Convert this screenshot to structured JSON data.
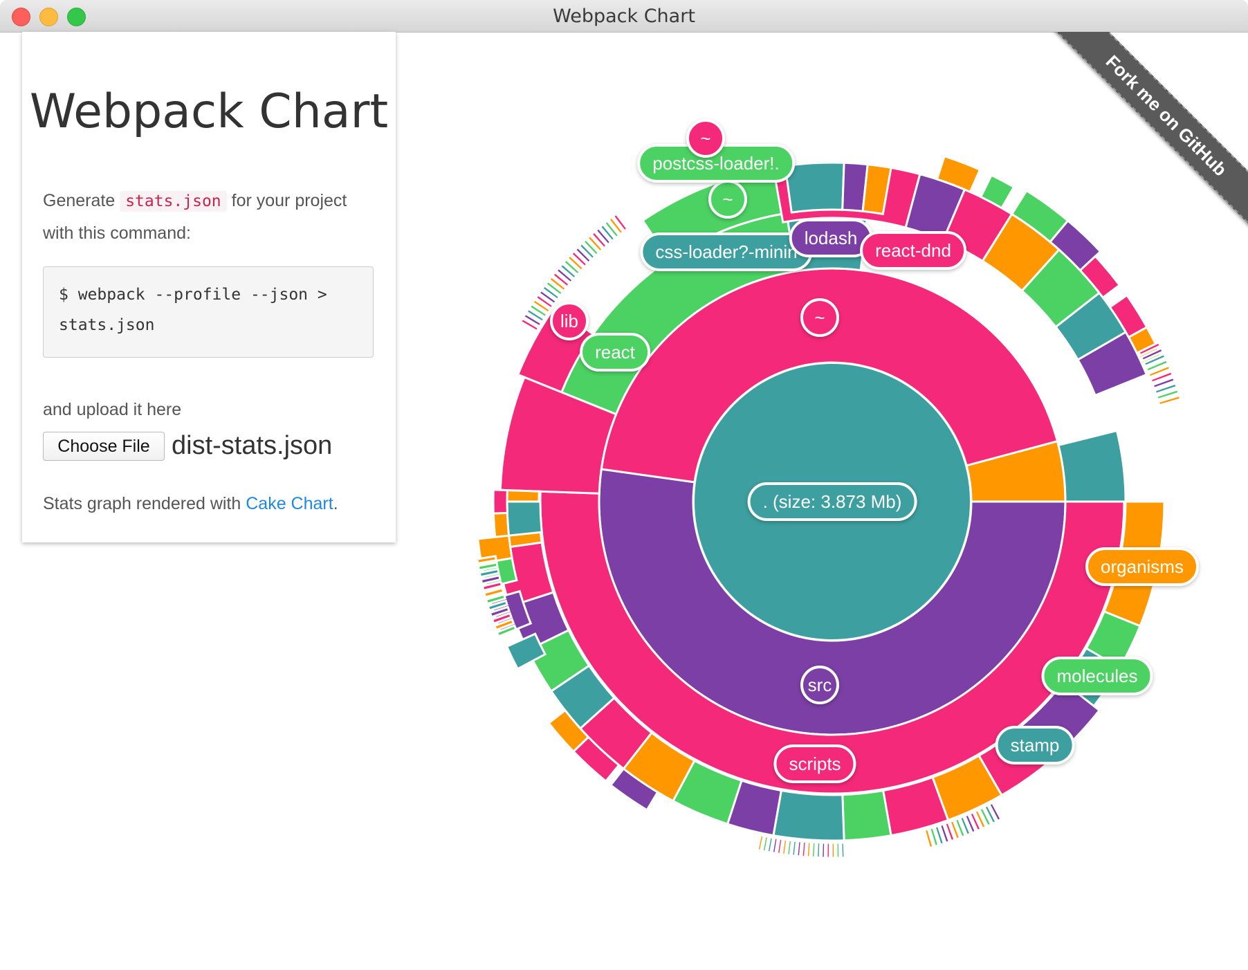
{
  "window": {
    "title": "Webpack Chart"
  },
  "card": {
    "heading": "Webpack Chart",
    "intro_before": "Generate ",
    "intro_code": "stats.json",
    "intro_after": " for your project with this command:",
    "command": "$ webpack --profile --json > stats.json",
    "upload_text": "and upload it here",
    "choose_file_label": "Choose File",
    "file_name": "dist-stats.json",
    "credit_before": "Stats graph rendered with ",
    "credit_link": "Cake Chart",
    "credit_after": "."
  },
  "ribbon": {
    "text": "Fork me on GitHub"
  },
  "colors": {
    "pink": "#f5297a",
    "purple": "#7b3fa5",
    "teal": "#3d9f9f",
    "green": "#4cd163",
    "orange": "#ff9800",
    "link": "#1e88e5"
  },
  "chart_data": {
    "type": "sunburst",
    "root_label": ". (size: 3.873 Mb)",
    "labels": [
      {
        "text": ". (size: 3.873 Mb)",
        "color": "teal"
      },
      {
        "text": "~",
        "color": "pink"
      },
      {
        "text": "src",
        "color": "purple"
      },
      {
        "text": "scripts",
        "color": "pink"
      },
      {
        "text": "lib",
        "color": "pink"
      },
      {
        "text": "react",
        "color": "green"
      },
      {
        "text": "css-loader?-minin",
        "color": "teal"
      },
      {
        "text": "lodash",
        "color": "purple"
      },
      {
        "text": "react-dnd",
        "color": "pink"
      },
      {
        "text": "~",
        "color": "green"
      },
      {
        "text": "postcss-loader!.",
        "color": "green"
      },
      {
        "text": "~",
        "color": "pink"
      },
      {
        "text": "organisms",
        "color": "orange"
      },
      {
        "text": "molecules",
        "color": "green"
      },
      {
        "text": "stamp",
        "color": "teal"
      }
    ]
  }
}
